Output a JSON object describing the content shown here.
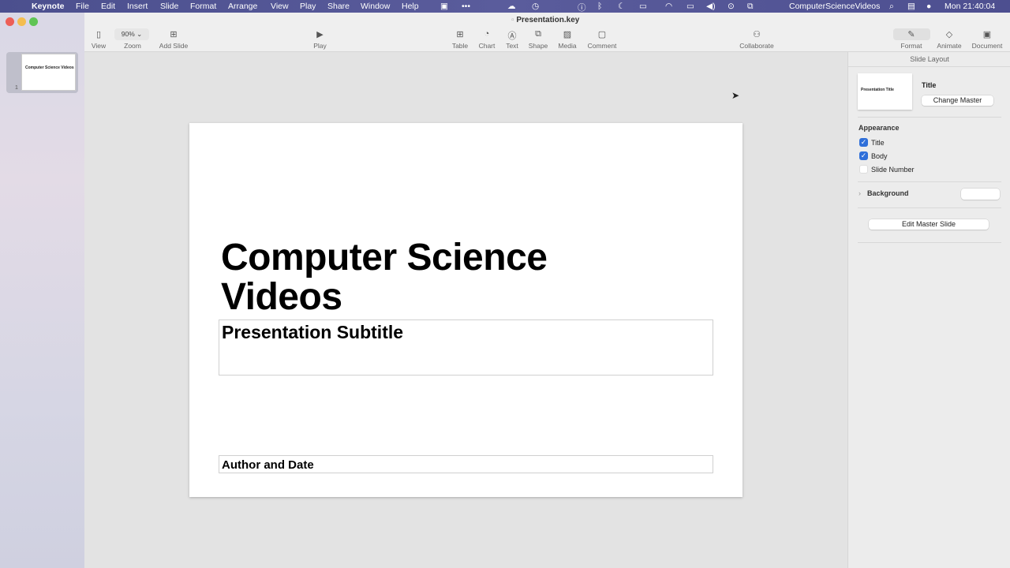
{
  "menubar": {
    "app": "Keynote",
    "items": [
      "File",
      "Edit",
      "Insert",
      "Slide",
      "Format",
      "Arrange",
      "View",
      "Play",
      "Share",
      "Window",
      "Help"
    ],
    "user": "ComputerScienceVideos",
    "clock": "Mon  21:40:04"
  },
  "window": {
    "title": "Presentation.key"
  },
  "toolbar": {
    "view": "View",
    "zoom_value": "90%",
    "zoom": "Zoom",
    "add_slide": "Add Slide",
    "play": "Play",
    "table": "Table",
    "chart": "Chart",
    "text": "Text",
    "shape": "Shape",
    "media": "Media",
    "comment": "Comment",
    "collaborate": "Collaborate",
    "format": "Format",
    "animate": "Animate",
    "document": "Document"
  },
  "navigator": {
    "slide_number": "1",
    "thumb_title": "Computer Science Videos"
  },
  "slide": {
    "title_line1": "Computer Science",
    "title_line2": "Videos",
    "subtitle": "Presentation Subtitle",
    "author": "Author and Date"
  },
  "inspector": {
    "header": "Slide Layout",
    "layout_name": "Title",
    "thumb_title": "Presentation Title",
    "change_master": "Change Master",
    "appearance": "Appearance",
    "title_cb": "Title",
    "body_cb": "Body",
    "slide_number_cb": "Slide Number",
    "background": "Background",
    "edit_master": "Edit Master Slide"
  }
}
